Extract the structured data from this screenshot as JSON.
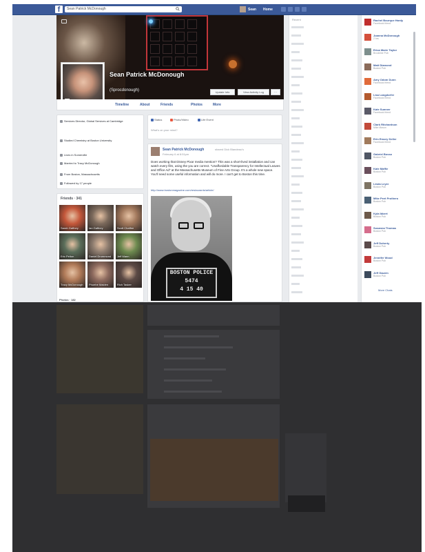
{
  "topbar": {
    "logo": "f",
    "search_value": "Sean Patrick McDonough",
    "user_name": "Sean",
    "home_label": "Home"
  },
  "profile": {
    "name": "Sean Patrick McDonough",
    "handle": "(Sprocdonough)",
    "update_info_label": "Update Info",
    "activity_log_label": "View Activity Log",
    "more_label": "···"
  },
  "tabs": [
    {
      "label": "Timeline"
    },
    {
      "label": "About"
    },
    {
      "label": "Friends"
    },
    {
      "label": "Photos"
    },
    {
      "label": "More"
    }
  ],
  "intro": [
    {
      "text": "Services Director, Global Services at Cambridge",
      "sub": ""
    },
    {
      "text": "Studied Chemistry at Boston University",
      "sub": ""
    },
    {
      "text": "Lives in Somerville",
      "sub": ""
    },
    {
      "text": "Married to Tracy McDonough",
      "sub": ""
    },
    {
      "text": "From Boston, Massachusetts",
      "sub": ""
    },
    {
      "text": "Followed by 17 people",
      "sub": ""
    }
  ],
  "friends": {
    "title": "Friends · 341",
    "list": [
      {
        "name": "Sarah Gaffney",
        "color": "#c4573a"
      },
      {
        "name": "Ian Gaffney",
        "color": "#7c6a5c"
      },
      {
        "name": "Scott Chaffee",
        "color": "#a2785c"
      },
      {
        "name": "Eric Pelton",
        "color": "#5b6e5a"
      },
      {
        "name": "Daniel Drummond",
        "color": "#8c7b6e"
      },
      {
        "name": "Jeff Mann",
        "color": "#6d8a4f"
      },
      {
        "name": "Tracy McDonough",
        "color": "#b07a58"
      },
      {
        "name": "Phoebe Maiden",
        "color": "#8d6a5e"
      },
      {
        "name": "Rich Tasker",
        "color": "#5c4a45"
      }
    ],
    "photos_label": "Photos · 182"
  },
  "composer": {
    "status_label": "Status",
    "photo_label": "Photo/Video",
    "life_label": "Life Event",
    "placeholder": "What's on your mind?"
  },
  "post": {
    "author": "Sean Patrick McDonough",
    "shared": "shared Dick Blandeau's",
    "date": "February 6 at 8:51pm",
    "text": "Does working that Disney Pixar media mention? This was a short-lived installation and can watch every film, using the you are correct. \"Unaffordable Transparency for Intellectual Leaves and Office Ad\" at the Massachusetts Museum of Fine Arts Group. It's a whole new space. You'll need some useful information and will do more. I can't get to Boston this time.",
    "link": "http://www.bostonmagazine.com/restaurants/article/",
    "plaque_line1": "BOSTON POLICE",
    "plaque_line2": "5474",
    "plaque_line3": "4 15 40"
  },
  "ticker": {
    "title": "Recent"
  },
  "chat": {
    "contacts": [
      {
        "name": "Rachel Bourque Hardy",
        "sub": "Facebook friend",
        "color": "#c02e2e"
      },
      {
        "name": "Joanna McDonough",
        "sub": "2 hrs",
        "color": "#d4503c"
      },
      {
        "name": "Erica Marie Taylor",
        "sub": "Brookline Pub",
        "color": "#7d8f8d"
      },
      {
        "name": "Matt Diamond",
        "sub": "Boston Pub",
        "color": "#8a6b5a"
      },
      {
        "name": "Amy Odom Dunn",
        "sub": "Facebook friend",
        "color": "#e06a3a"
      },
      {
        "name": "Lisa Langdorfer",
        "sub": "Facebook friend",
        "color": "#b35a2e"
      },
      {
        "name": "Kate Sumner",
        "sub": "Facebook friend",
        "color": "#5a5a68"
      },
      {
        "name": "Clark Ritchardson",
        "sub": "Mike Mason",
        "color": "#c24a3a"
      },
      {
        "name": "Erin Emory Deller",
        "sub": "Facebook friend",
        "color": "#a07a5c"
      },
      {
        "name": "Gabriel Bosso",
        "sub": "Boston Pub",
        "color": "#4f5664"
      },
      {
        "name": "Kate Maffie",
        "sub": "Boston Pub",
        "color": "#6a4f5c"
      },
      {
        "name": "Linda Leyer",
        "sub": "Boston Pub",
        "color": "#7e7464"
      },
      {
        "name": "Mike Peet Prothero",
        "sub": "Boston Pub",
        "color": "#4a6074"
      },
      {
        "name": "Kyla Ibbert",
        "sub": "Boston Pub",
        "color": "#6d5a4a"
      },
      {
        "name": "Susanna Thomas",
        "sub": "Boston Pub",
        "color": "#d56d8c"
      },
      {
        "name": "Jeff Doherty",
        "sub": "Boston Pub",
        "color": "#5a4a4a"
      },
      {
        "name": "Jennifer Wood",
        "sub": "Boston Pub",
        "color": "#c23a3a"
      },
      {
        "name": "Jeff Gauvin",
        "sub": "Boston Pub",
        "color": "#3c4a5c"
      }
    ],
    "more_label": "More Chats"
  }
}
